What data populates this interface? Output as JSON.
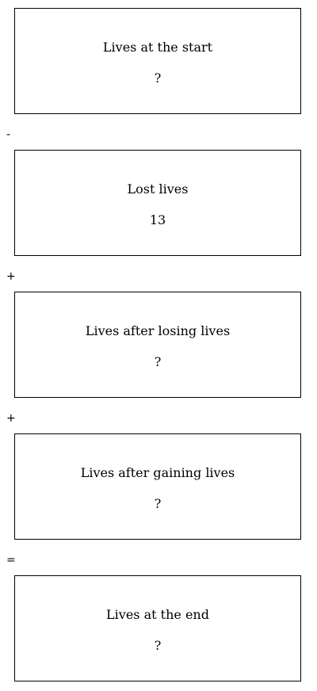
{
  "boxes": [
    {
      "label": "Lives at the start",
      "value": "?"
    },
    {
      "label": "Lost lives",
      "value": "13"
    },
    {
      "label": "Lives after losing lives",
      "value": "?"
    },
    {
      "label": "Lives after gaining lives",
      "value": "?"
    },
    {
      "label": "Lives at the end",
      "value": "?"
    }
  ],
  "operators": [
    "-",
    "+",
    "+",
    "="
  ]
}
